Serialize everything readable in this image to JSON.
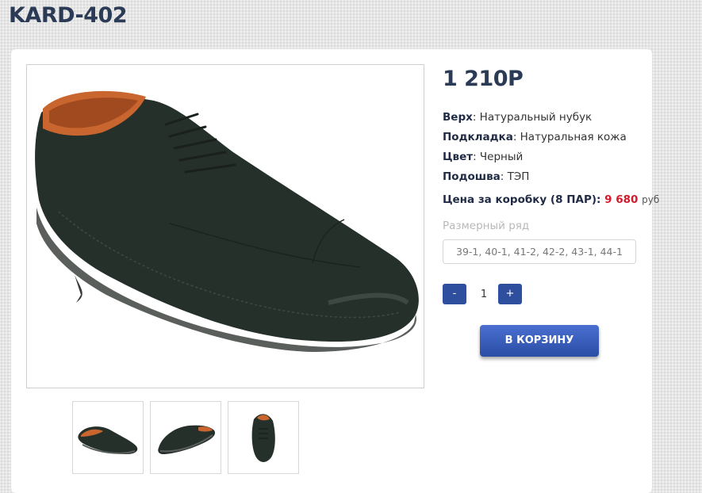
{
  "product": {
    "title": "KARD-402",
    "price": "1 210Р",
    "specs": [
      {
        "label": "Верх",
        "value": "Натуральный нубук"
      },
      {
        "label": "Подкладка",
        "value": "Натуральная кожа"
      },
      {
        "label": "Цвет",
        "value": "Черный"
      },
      {
        "label": "Подошва",
        "value": "ТЭП"
      }
    ],
    "box_price": {
      "label": "Цена за коробку (8 ПАР):",
      "value": "9 680",
      "currency": "руб"
    },
    "size_range": {
      "label": "Размерный ряд",
      "value": "39-1, 40-1, 41-2, 42-2, 43-1, 44-1"
    },
    "quantity": {
      "minus": "-",
      "value": "1",
      "plus": "+"
    },
    "cart_button": "В КОРЗИНУ",
    "images": {
      "main": "shoe-main-image",
      "thumbs": [
        "shoe-side-thumb",
        "shoe-angle-thumb",
        "shoe-front-thumb"
      ]
    }
  },
  "colors": {
    "title": "#2b3a55",
    "accent": "#2d4f9e",
    "price_red": "#d41a2a",
    "shoe": "#26302b"
  }
}
